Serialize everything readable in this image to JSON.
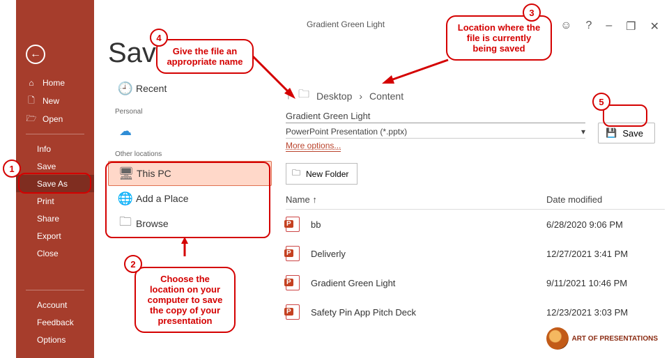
{
  "sidebar": {
    "home": "Home",
    "new": "New",
    "open": "Open",
    "info": "Info",
    "save": "Save",
    "saveas": "Save As",
    "print": "Print",
    "share": "Share",
    "export": "Export",
    "close": "Close",
    "account": "Account",
    "feedback": "Feedback",
    "options": "Options"
  },
  "mid": {
    "title": "Save A",
    "recent": "Recent",
    "personal_lbl": "Personal",
    "other_lbl": "Other locations",
    "thispc": "This PC",
    "addplace": "Add a Place",
    "browse": "Browse"
  },
  "main": {
    "doc_title": "Gradient Green Light",
    "breadcrumb_1": "Desktop",
    "breadcrumb_2": "Content",
    "filename": "Gradient Green Light",
    "filetype": "PowerPoint Presentation (*.pptx)",
    "more": "More options...",
    "newfolder": "New Folder",
    "save": "Save",
    "col_name": "Name",
    "col_date": "Date modified",
    "files": [
      {
        "n": "bb",
        "d": "6/28/2020 9:06 PM"
      },
      {
        "n": "Deliverly",
        "d": "12/27/2021 3:41 PM"
      },
      {
        "n": "Gradient Green Light",
        "d": "9/11/2021 10:46 PM"
      },
      {
        "n": "Safety Pin App Pitch Deck",
        "d": "12/23/2021 3:03 PM"
      }
    ]
  },
  "callouts": {
    "c1": "1",
    "c2": "2",
    "c3": "3",
    "c4": "4",
    "c5": "5",
    "t2": "Choose the location on your computer to save the copy of your presentation",
    "t3": "Location where the file is currently being saved",
    "t4": "Give the file an appropriate name"
  },
  "logo": "ART OF PRESENTATIONS",
  "icons": {
    "back": "←",
    "home": "⌂",
    "new": "🗋",
    "open": "🗁",
    "clock": "🕘",
    "onedrive": "☁",
    "up": "↑",
    "folder": "🗀",
    "this_pc": "🖥",
    "globe": "🌐",
    "save": "💾",
    "dropdown": "▾",
    "sort": "↑",
    "smile": "☺",
    "help": "?",
    "min": "–",
    "restore": "❐",
    "close": "✕"
  }
}
